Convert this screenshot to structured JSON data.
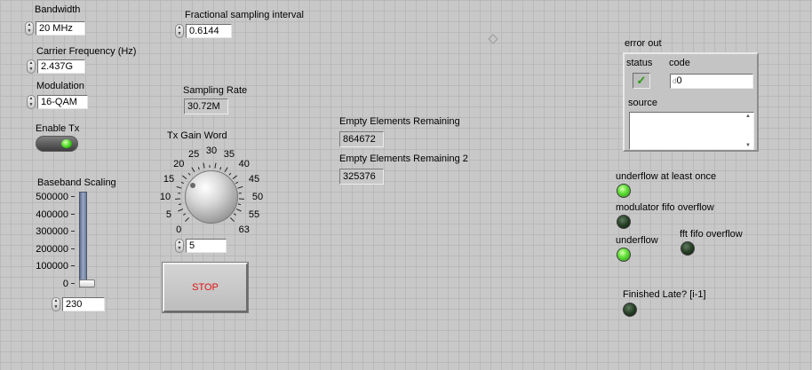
{
  "controls": {
    "bandwidth": {
      "label": "Bandwidth",
      "value": "20 MHz"
    },
    "carrier_frequency": {
      "label": "Carrier Frequency (Hz)",
      "value": "2.437G"
    },
    "modulation": {
      "label": "Modulation",
      "value": "16-QAM"
    },
    "enable_tx": {
      "label": "Enable Tx",
      "state": true
    },
    "fractional_sampling_interval": {
      "label": "Fractional sampling interval",
      "value": "0.6144"
    },
    "baseband_scaling": {
      "label": "Baseband Scaling",
      "scale_labels": [
        "500000",
        "400000",
        "300000",
        "200000",
        "100000",
        "0"
      ],
      "value": "230",
      "max": 500000
    },
    "tx_gain_word": {
      "label": "Tx Gain Word",
      "dial_labels": [
        "0",
        "5",
        "10",
        "15",
        "20",
        "25",
        "30",
        "35",
        "40",
        "45",
        "50",
        "55",
        "63"
      ],
      "value": "5"
    },
    "stop_button": {
      "label": "STOP"
    }
  },
  "indicators": {
    "sampling_rate": {
      "label": "Sampling Rate",
      "value": "30.72M"
    },
    "empty_elements_remaining": {
      "label": "Empty Elements Remaining",
      "value": "864672"
    },
    "empty_elements_remaining_2": {
      "label": "Empty Elements Remaining 2",
      "value": "325376"
    },
    "error_out": {
      "label": "error out",
      "status_label": "status",
      "status_glyph": "✓",
      "code_label": "code",
      "code_value": "0",
      "code_prefix": "d",
      "source_label": "source",
      "source_value": ""
    },
    "leds": {
      "underflow_at_least_once": {
        "label": "underflow at least once",
        "on": true
      },
      "modulator_fifo_overflow": {
        "label": "modulator fifo overflow",
        "on": false
      },
      "underflow": {
        "label": "underflow",
        "on": true
      },
      "fft_fifo_overflow": {
        "label": "fft fifo overflow",
        "on": false
      },
      "finished_late": {
        "label": "Finished Late? [i-1]",
        "on": false
      }
    }
  },
  "colors": {
    "led_on": "#63e23a",
    "led_off": "#223a22",
    "stop_text": "#e01010",
    "check_green": "#2a9a10"
  }
}
